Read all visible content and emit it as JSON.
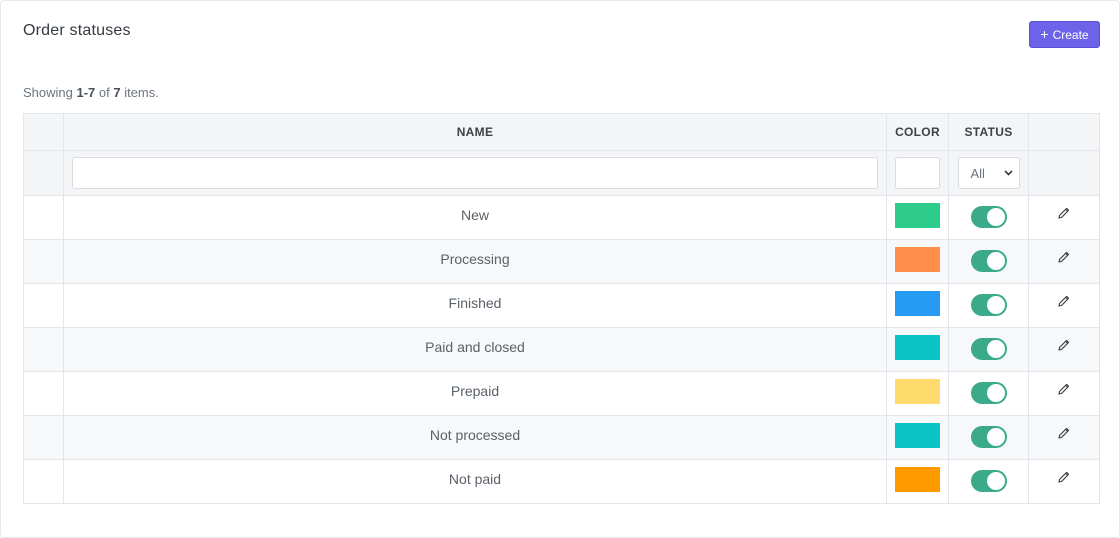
{
  "header": {
    "title": "Order statuses",
    "create_label": "Create",
    "create_icon": "plus-icon"
  },
  "summary": {
    "prefix": "Showing ",
    "range": "1-7",
    "middle": " of ",
    "total": "7",
    "suffix": " items."
  },
  "table": {
    "columns": [
      "",
      "NAME",
      "COLOR",
      "STATUS",
      ""
    ],
    "filters": {
      "name_value": "",
      "color_value": "",
      "status_selected": "All"
    },
    "rows": [
      {
        "name": "New",
        "color": "#2ecc8a",
        "status": true
      },
      {
        "name": "Processing",
        "color": "#ff8f4a",
        "status": true
      },
      {
        "name": "Finished",
        "color": "#2699f2",
        "status": true
      },
      {
        "name": "Paid and closed",
        "color": "#0cc4c4",
        "status": true
      },
      {
        "name": "Prepaid",
        "color": "#ffdb6e",
        "status": true
      },
      {
        "name": "Not processed",
        "color": "#0cc4c4",
        "status": true
      },
      {
        "name": "Not paid",
        "color": "#ff9900",
        "status": true
      }
    ],
    "row_action_icon": "pencil-icon"
  },
  "colors": {
    "accent": "#6c63e8",
    "toggle_on": "#3aaa8a"
  }
}
